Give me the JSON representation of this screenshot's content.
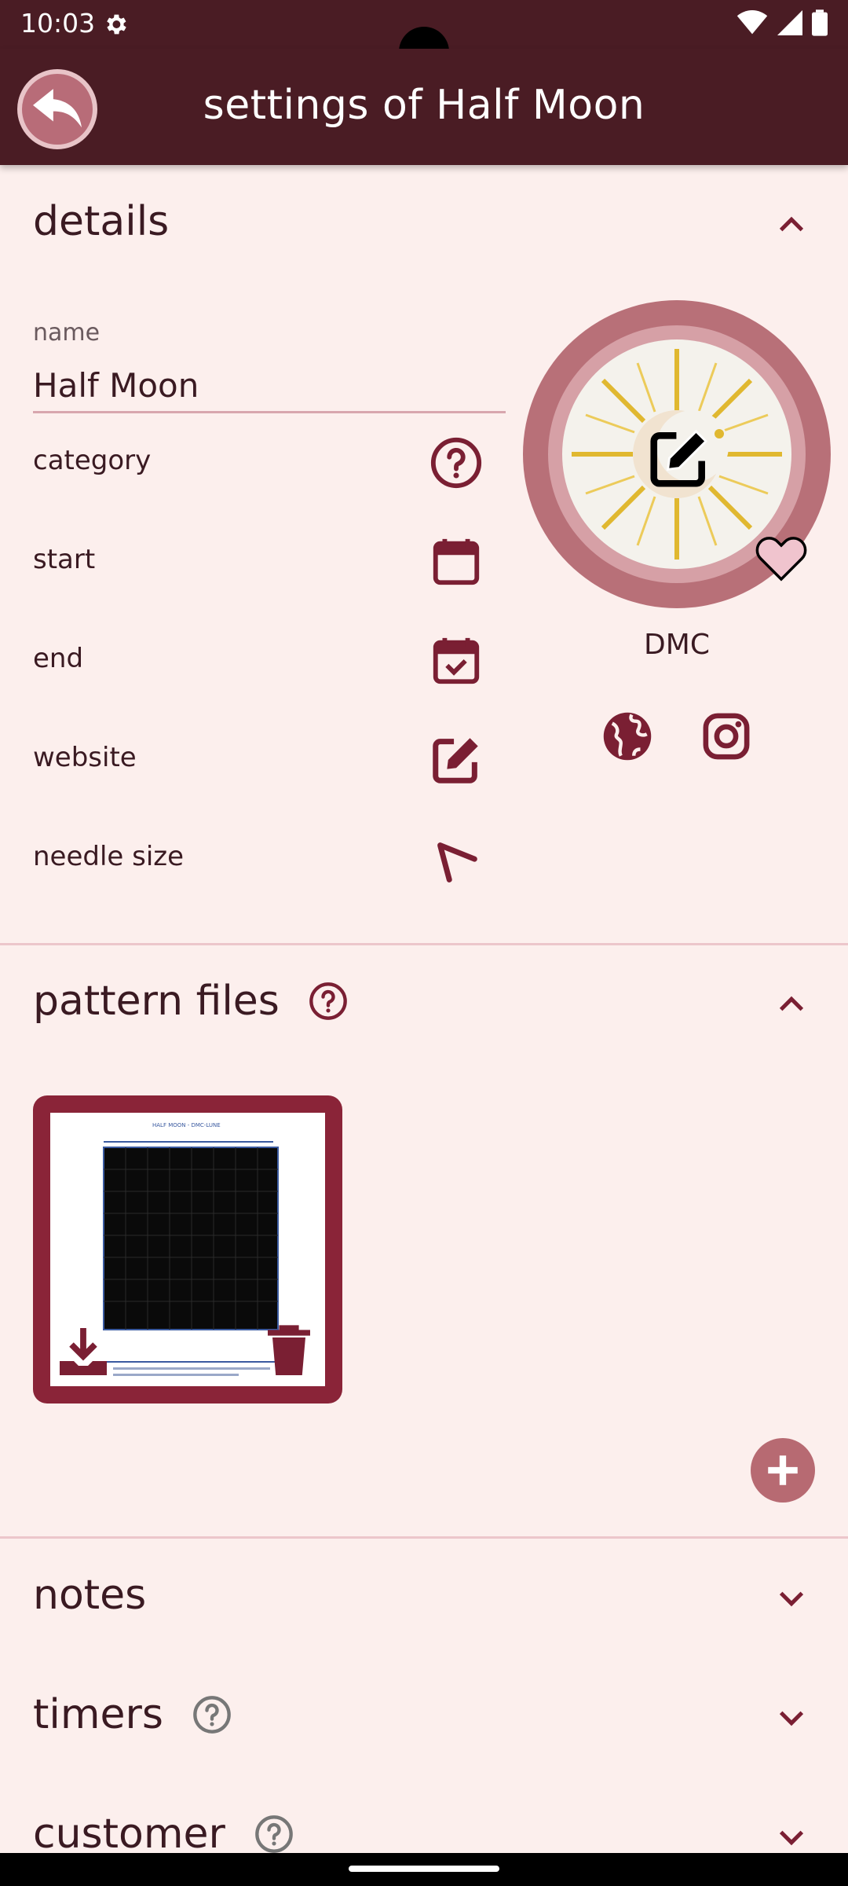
{
  "status_bar": {
    "time": "10:03"
  },
  "app_bar": {
    "title": "settings of Half Moon"
  },
  "details": {
    "header": "details",
    "name_caption": "name",
    "name_value": "Half Moon",
    "fields": [
      {
        "label": "category",
        "icon": "help-circle-icon"
      },
      {
        "label": "start",
        "icon": "calendar-icon"
      },
      {
        "label": "end",
        "icon": "calendar-check-icon"
      },
      {
        "label": "website",
        "icon": "edit-icon"
      },
      {
        "label": "needle size",
        "icon": "needle-icon"
      }
    ],
    "brand": "DMC"
  },
  "pattern_files": {
    "header": "pattern files",
    "file_preview_title": "HALF MOON - DMC-LUNE"
  },
  "notes": {
    "header": "notes"
  },
  "timers": {
    "header": "timers"
  },
  "customer": {
    "header": "customer"
  },
  "colors": {
    "primary": "#4a1c24",
    "accent": "#8a2438",
    "background": "#fcefed",
    "icon": "#7a1f33"
  }
}
